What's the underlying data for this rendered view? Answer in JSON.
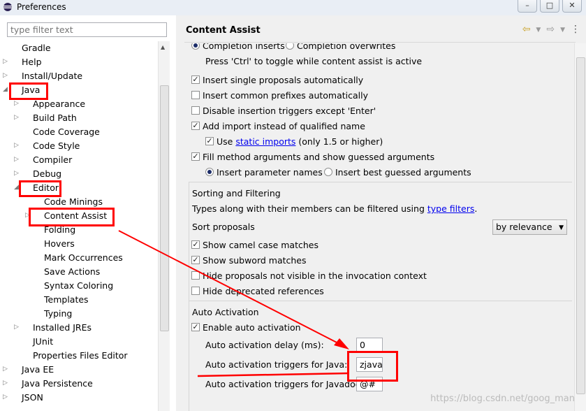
{
  "window": {
    "title": "Preferences",
    "controls": [
      "–",
      "□",
      "✕"
    ]
  },
  "filter": {
    "placeholder": "type filter text"
  },
  "tree": [
    {
      "label": "Gradle",
      "depth": 1,
      "tw": ""
    },
    {
      "label": "Help",
      "depth": 1,
      "tw": "▷"
    },
    {
      "label": "Install/Update",
      "depth": 1,
      "tw": "▷"
    },
    {
      "label": "Java",
      "depth": 1,
      "tw": "◢"
    },
    {
      "label": "Appearance",
      "depth": 2,
      "tw": "▷"
    },
    {
      "label": "Build Path",
      "depth": 2,
      "tw": "▷"
    },
    {
      "label": "Code Coverage",
      "depth": 2,
      "tw": ""
    },
    {
      "label": "Code Style",
      "depth": 2,
      "tw": "▷"
    },
    {
      "label": "Compiler",
      "depth": 2,
      "tw": "▷"
    },
    {
      "label": "Debug",
      "depth": 2,
      "tw": "▷"
    },
    {
      "label": "Editor",
      "depth": 2,
      "tw": "◢"
    },
    {
      "label": "Code Minings",
      "depth": 3,
      "tw": ""
    },
    {
      "label": "Content Assist",
      "depth": 3,
      "tw": "▷"
    },
    {
      "label": "Folding",
      "depth": 3,
      "tw": ""
    },
    {
      "label": "Hovers",
      "depth": 3,
      "tw": ""
    },
    {
      "label": "Mark Occurrences",
      "depth": 3,
      "tw": ""
    },
    {
      "label": "Save Actions",
      "depth": 3,
      "tw": ""
    },
    {
      "label": "Syntax Coloring",
      "depth": 3,
      "tw": ""
    },
    {
      "label": "Templates",
      "depth": 3,
      "tw": ""
    },
    {
      "label": "Typing",
      "depth": 3,
      "tw": ""
    },
    {
      "label": "Installed JREs",
      "depth": 2,
      "tw": "▷"
    },
    {
      "label": "JUnit",
      "depth": 2,
      "tw": ""
    },
    {
      "label": "Properties Files Editor",
      "depth": 2,
      "tw": ""
    },
    {
      "label": "Java EE",
      "depth": 1,
      "tw": "▷"
    },
    {
      "label": "Java Persistence",
      "depth": 1,
      "tw": "▷"
    },
    {
      "label": "JSON",
      "depth": 1,
      "tw": "▷"
    }
  ],
  "page": {
    "title": "Content Assist"
  },
  "completion": {
    "inserts": "Completion inserts",
    "overwrites": "Completion overwrites",
    "toggle_hint": "Press 'Ctrl' to toggle while content assist is active"
  },
  "options": {
    "insert_single": "Insert single proposals automatically",
    "insert_common": "Insert common prefixes automatically",
    "disable_triggers": "Disable insertion triggers except 'Enter'",
    "add_import": "Add import instead of qualified name",
    "use_prefix": "Use",
    "static_imports": "static imports",
    "use_suffix": "(only 1.5 or higher)",
    "fill_args": "Fill method arguments and show guessed arguments",
    "insert_param_names": "Insert parameter names",
    "insert_best_guessed": "Insert best guessed arguments"
  },
  "sorting": {
    "heading": "Sorting and Filtering",
    "types_text": "Types along with their members can be filtered using",
    "type_filters": "type filters",
    "period": ".",
    "sort_label": "Sort proposals",
    "sort_value": "by relevance",
    "camel_case": "Show camel case matches",
    "subword": "Show subword matches",
    "hide_invisible": "Hide proposals not visible in the invocation context",
    "hide_deprecated": "Hide deprecated references"
  },
  "auto_activation": {
    "heading": "Auto Activation",
    "enable": "Enable auto activation",
    "delay_label": "Auto activation delay (ms):",
    "delay_value": "0",
    "java_label": "Auto activation triggers for Java:",
    "java_value": "zjava",
    "javadoc_label": "Auto activation triggers for Javadoc:",
    "javadoc_value": "@#"
  },
  "watermark": "https://blog.csdn.net/goog_man",
  "colors": {
    "annotation_red": "#ff0000"
  }
}
